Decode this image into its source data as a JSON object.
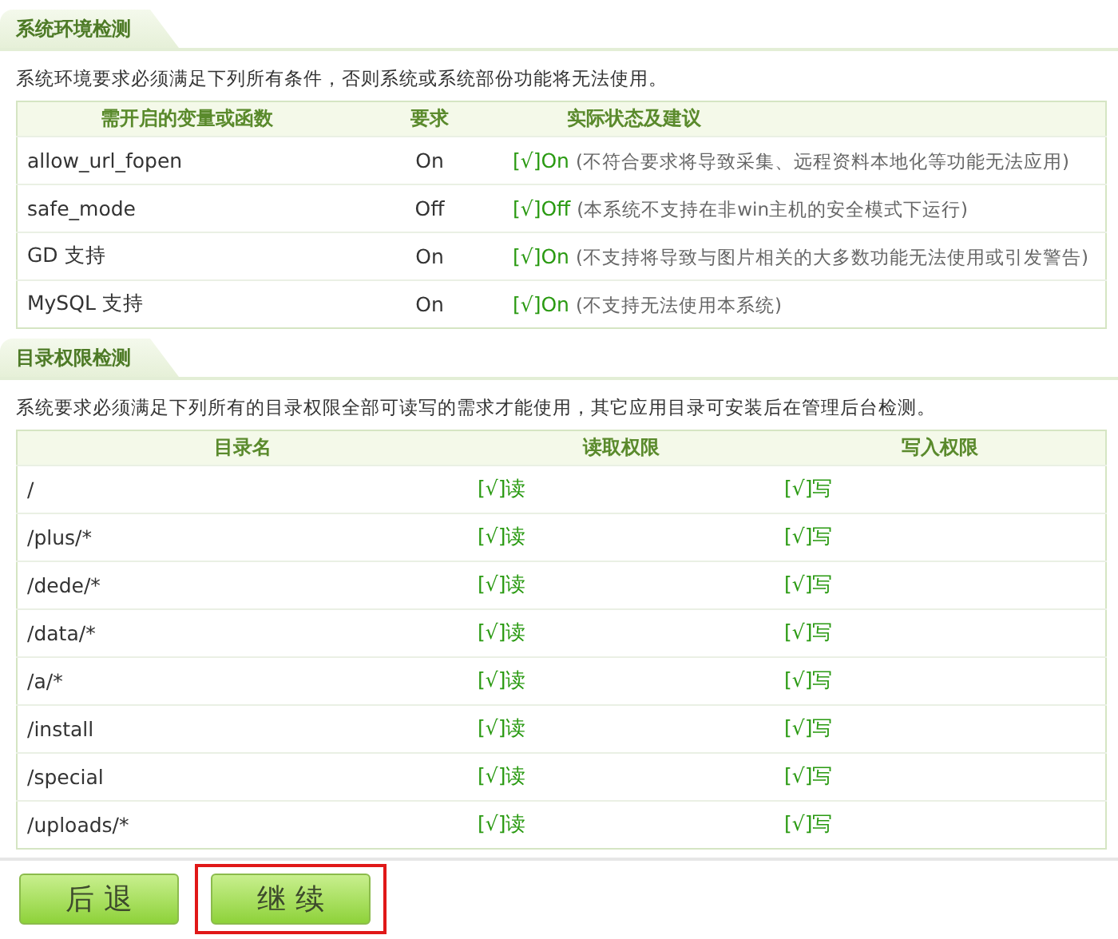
{
  "sections": [
    {
      "title": "系统环境检测",
      "description": "系统环境要求必须满足下列所有条件，否则系统或系统部份功能将无法使用。",
      "kind": "env",
      "columns": [
        "需开启的变量或函数",
        "要求",
        "实际状态及建议"
      ],
      "rows": [
        {
          "name": "allow_url_fopen",
          "required": "On",
          "status": "[√]On",
          "note": "(不符合要求将导致采集、远程资料本地化等功能无法应用)"
        },
        {
          "name": "safe_mode",
          "required": "Off",
          "status": "[√]Off",
          "note": "(本系统不支持在非win主机的安全模式下运行)"
        },
        {
          "name": "GD 支持",
          "required": "On",
          "status": "[√]On",
          "note": "(不支持将导致与图片相关的大多数功能无法使用或引发警告)"
        },
        {
          "name": "MySQL 支持",
          "required": "On",
          "status": "[√]On",
          "note": "(不支持无法使用本系统)"
        }
      ]
    },
    {
      "title": "目录权限检测",
      "description": "系统要求必须满足下列所有的目录权限全部可读写的需求才能使用，其它应用目录可安装后在管理后台检测。",
      "kind": "dir",
      "columns": [
        "目录名",
        "读取权限",
        "写入权限"
      ],
      "rows": [
        {
          "name": "/",
          "read": "[√]读",
          "write": "[√]写"
        },
        {
          "name": "/plus/*",
          "read": "[√]读",
          "write": "[√]写"
        },
        {
          "name": "/dede/*",
          "read": "[√]读",
          "write": "[√]写"
        },
        {
          "name": "/data/*",
          "read": "[√]读",
          "write": "[√]写"
        },
        {
          "name": "/a/*",
          "read": "[√]读",
          "write": "[√]写"
        },
        {
          "name": "/install",
          "read": "[√]读",
          "write": "[√]写"
        },
        {
          "name": "/special",
          "read": "[√]读",
          "write": "[√]写"
        },
        {
          "name": "/uploads/*",
          "read": "[√]读",
          "write": "[√]写"
        }
      ]
    }
  ],
  "buttons": [
    {
      "label": "后 退",
      "highlighted": false
    },
    {
      "label": "继 续",
      "highlighted": true
    }
  ]
}
